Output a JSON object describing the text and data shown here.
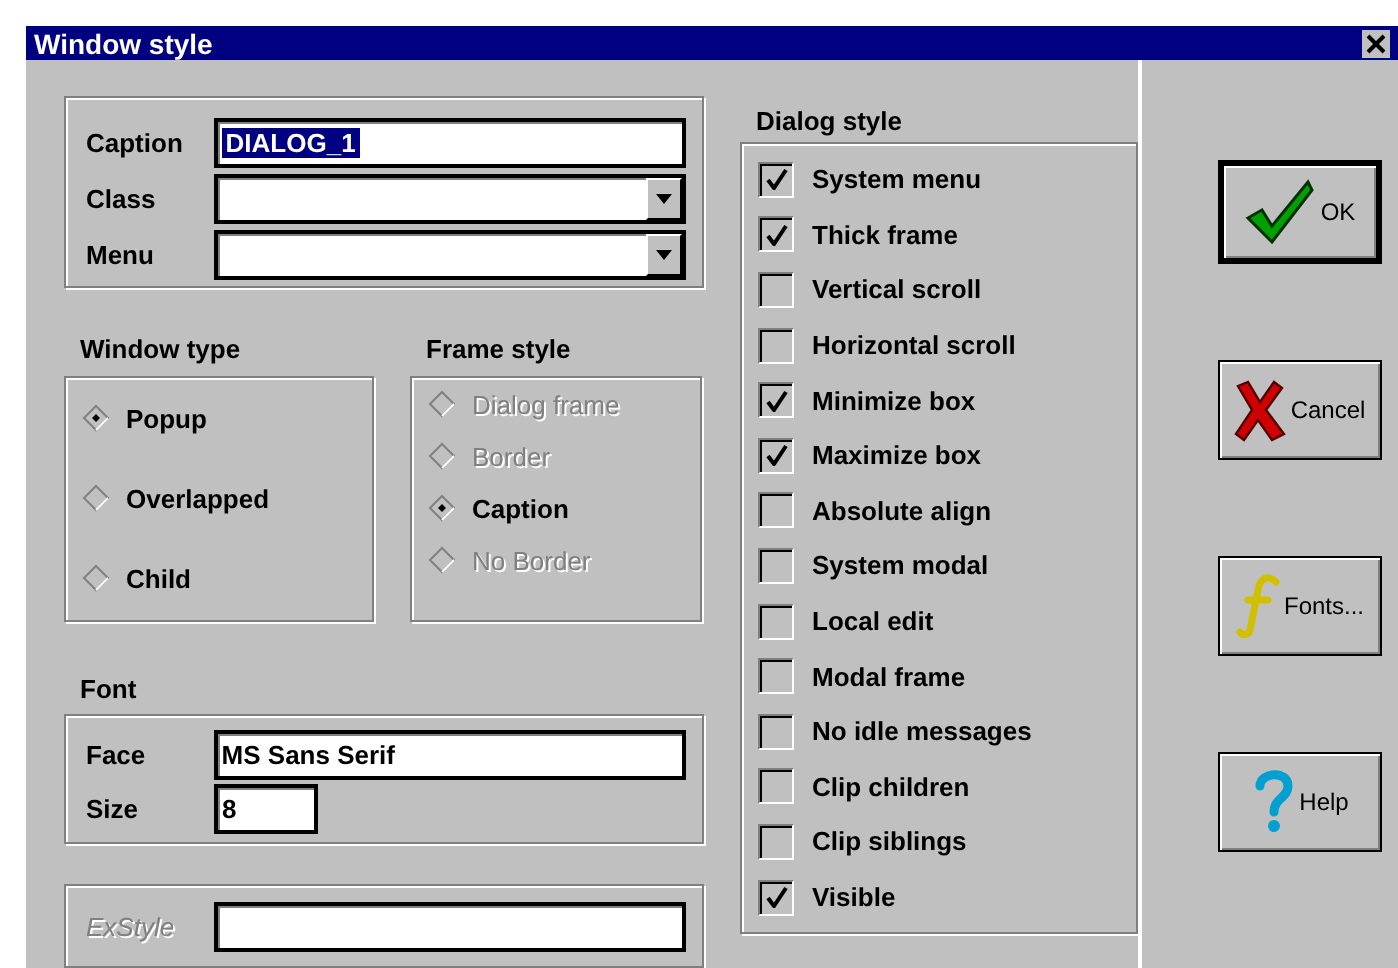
{
  "window": {
    "title": "Window style"
  },
  "identity": {
    "fields": [
      {
        "label": "Caption",
        "kind": "text",
        "value": "DIALOG_1",
        "highlighted": true
      },
      {
        "label": "Class",
        "kind": "combo"
      },
      {
        "label": "Menu",
        "kind": "combo"
      }
    ]
  },
  "window_type": {
    "label": "Window type",
    "options": [
      {
        "label": "Popup",
        "selected": true,
        "disabled": false
      },
      {
        "label": "Overlapped",
        "selected": false,
        "disabled": false
      },
      {
        "label": "Child",
        "selected": false,
        "disabled": false
      }
    ]
  },
  "frame_style": {
    "label": "Frame style",
    "options": [
      {
        "label": "Dialog frame",
        "selected": false,
        "disabled": true
      },
      {
        "label": "Border",
        "selected": false,
        "disabled": true
      },
      {
        "label": "Caption",
        "selected": true,
        "disabled": false
      },
      {
        "label": "No Border",
        "selected": false,
        "disabled": true
      }
    ]
  },
  "font": {
    "label": "Font",
    "face": {
      "label": "Face",
      "value": "MS Sans Serif"
    },
    "size": {
      "label": "Size",
      "value": "8"
    }
  },
  "exstyle": {
    "label": "ExStyle",
    "disabled": true
  },
  "dialog_style": {
    "label": "Dialog style",
    "options": [
      {
        "label": "System menu",
        "checked": true
      },
      {
        "label": "Thick frame",
        "checked": true
      },
      {
        "label": "Vertical scroll",
        "checked": false
      },
      {
        "label": "Horizontal scroll",
        "checked": false
      },
      {
        "label": "Minimize box",
        "checked": true
      },
      {
        "label": "Maximize box",
        "checked": true
      },
      {
        "label": "Absolute align",
        "checked": false
      },
      {
        "label": "System modal",
        "checked": false
      },
      {
        "label": "Local edit",
        "checked": false
      },
      {
        "label": "Modal frame",
        "checked": false
      },
      {
        "label": "No idle messages",
        "checked": false
      },
      {
        "label": "Clip children",
        "checked": false
      },
      {
        "label": "Clip siblings",
        "checked": false
      },
      {
        "label": "Visible",
        "checked": true
      }
    ]
  },
  "buttons": [
    {
      "label": "OK",
      "kind": "ok",
      "default": true
    },
    {
      "label": "Cancel",
      "kind": "cancel",
      "default": false
    },
    {
      "label": "Fonts...",
      "kind": "fonts",
      "default": false
    },
    {
      "label": "Help",
      "kind": "help",
      "default": false
    }
  ]
}
